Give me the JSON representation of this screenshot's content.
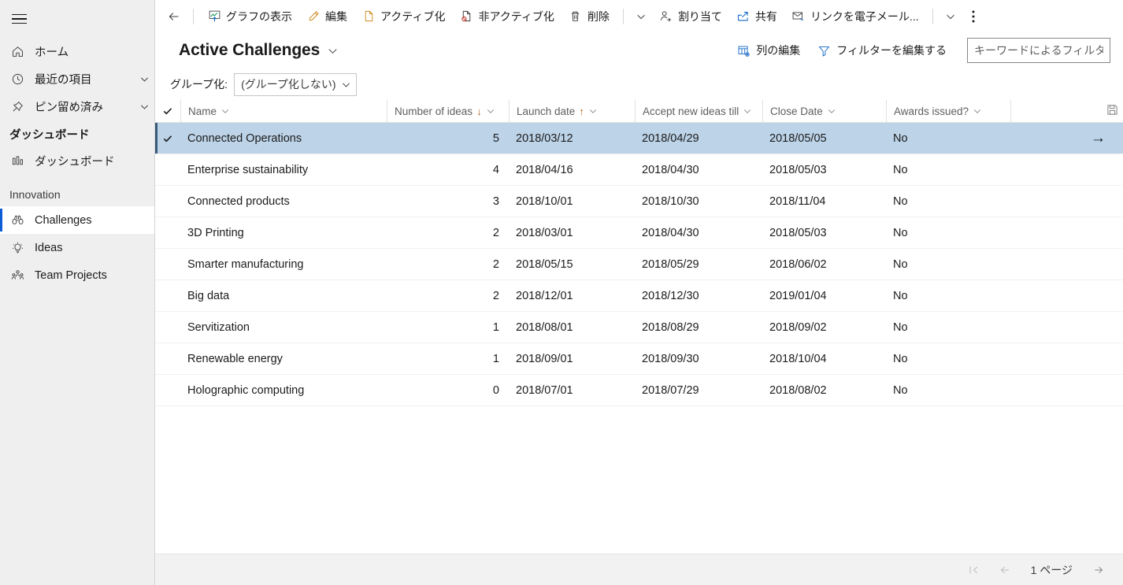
{
  "sidebar": {
    "hamburger_label": "メニュー",
    "items": [
      {
        "label": "ホーム",
        "icon": "home-icon",
        "chevron": false
      },
      {
        "label": "最近の項目",
        "icon": "clock-icon",
        "chevron": true
      },
      {
        "label": "ピン留め済み",
        "icon": "pin-icon",
        "chevron": true
      }
    ],
    "group_title": "ダッシュボード",
    "dashboard_item": {
      "label": "ダッシュボード",
      "icon": "dashboard-icon"
    },
    "section_title": "Innovation",
    "section_items": [
      {
        "label": "Challenges",
        "icon": "binoculars-icon",
        "selected": true
      },
      {
        "label": "Ideas",
        "icon": "lightbulb-icon",
        "selected": false
      },
      {
        "label": "Team Projects",
        "icon": "people-icon",
        "selected": false
      }
    ],
    "accent_color": "#0b5cd5"
  },
  "commandbar": {
    "back_label": "戻る",
    "buttons": [
      {
        "label": "グラフの表示",
        "icon": "chart-icon"
      },
      {
        "label": "編集",
        "icon": "pencil-icon"
      },
      {
        "label": "アクティブ化",
        "icon": "activate-doc-icon"
      },
      {
        "label": "非アクティブ化",
        "icon": "deactivate-doc-icon"
      },
      {
        "label": "削除",
        "icon": "trash-icon"
      }
    ],
    "first_chevron": "chevron-down-icon",
    "buttons2": [
      {
        "label": "割り当て",
        "icon": "assign-person-icon"
      },
      {
        "label": "共有",
        "icon": "share-icon"
      },
      {
        "label": "リンクを電子メール...",
        "icon": "email-link-icon"
      }
    ],
    "second_chevron": "chevron-down-icon",
    "overflow_label": "その他のコマンド"
  },
  "header": {
    "title": "Active Challenges",
    "title_chevron": "chevron-down-icon",
    "edit_columns": {
      "label": "列の編集",
      "icon": "columns-icon"
    },
    "edit_filters": {
      "label": "フィルターを編集する",
      "icon": "funnel-icon"
    },
    "keyword_filter": {
      "placeholder": "キーワードによるフィルター",
      "value": ""
    }
  },
  "groupby": {
    "label": "グループ化:",
    "selected": "(グループ化しない)",
    "chevron": "chevron-down-icon"
  },
  "grid": {
    "select_all_icon": "checkmark-icon",
    "save_icon": "save-icon",
    "columns": [
      {
        "key": "name",
        "label": "Name",
        "sort": "",
        "chevron": true
      },
      {
        "key": "ideas",
        "label": "Number of ideas",
        "sort": "↓",
        "chevron": true
      },
      {
        "key": "launch",
        "label": "Launch date",
        "sort": "↑",
        "chevron": true
      },
      {
        "key": "accept",
        "label": "Accept new ideas till",
        "sort": "",
        "chevron": true
      },
      {
        "key": "close",
        "label": "Close Date",
        "sort": "",
        "chevron": true
      },
      {
        "key": "awards",
        "label": "Awards issued?",
        "sort": "",
        "chevron": true
      }
    ],
    "rows": [
      {
        "selected": true,
        "checked": true,
        "name": "Connected Operations",
        "ideas": "5",
        "launch": "2018/03/12",
        "accept": "2018/04/29",
        "close": "2018/05/05",
        "awards": "No",
        "arrow": "→"
      },
      {
        "selected": false,
        "checked": false,
        "name": "Enterprise sustainability",
        "ideas": "4",
        "launch": "2018/04/16",
        "accept": "2018/04/30",
        "close": "2018/05/03",
        "awards": "No",
        "arrow": ""
      },
      {
        "selected": false,
        "checked": false,
        "name": "Connected products",
        "ideas": "3",
        "launch": "2018/10/01",
        "accept": "2018/10/30",
        "close": "2018/11/04",
        "awards": "No",
        "arrow": ""
      },
      {
        "selected": false,
        "checked": false,
        "name": "3D Printing",
        "ideas": "2",
        "launch": "2018/03/01",
        "accept": "2018/04/30",
        "close": "2018/05/03",
        "awards": "No",
        "arrow": ""
      },
      {
        "selected": false,
        "checked": false,
        "name": "Smarter manufacturing",
        "ideas": "2",
        "launch": "2018/05/15",
        "accept": "2018/05/29",
        "close": "2018/06/02",
        "awards": "No",
        "arrow": ""
      },
      {
        "selected": false,
        "checked": false,
        "name": "Big data",
        "ideas": "2",
        "launch": "2018/12/01",
        "accept": "2018/12/30",
        "close": "2019/01/04",
        "awards": "No",
        "arrow": ""
      },
      {
        "selected": false,
        "checked": false,
        "name": "Servitization",
        "ideas": "1",
        "launch": "2018/08/01",
        "accept": "2018/08/29",
        "close": "2018/09/02",
        "awards": "No",
        "arrow": ""
      },
      {
        "selected": false,
        "checked": false,
        "name": "Renewable energy",
        "ideas": "1",
        "launch": "2018/09/01",
        "accept": "2018/09/30",
        "close": "2018/10/04",
        "awards": "No",
        "arrow": ""
      },
      {
        "selected": false,
        "checked": false,
        "name": "Holographic computing",
        "ideas": "0",
        "launch": "2018/07/01",
        "accept": "2018/07/29",
        "close": "2018/08/02",
        "awards": "No",
        "arrow": ""
      }
    ],
    "selection_color": "#bcd3e8"
  },
  "footer": {
    "first_page_icon": "page-first-icon",
    "prev_page_icon": "page-prev-icon",
    "page_label": "1 ページ",
    "next_page_icon": "page-next-icon"
  }
}
